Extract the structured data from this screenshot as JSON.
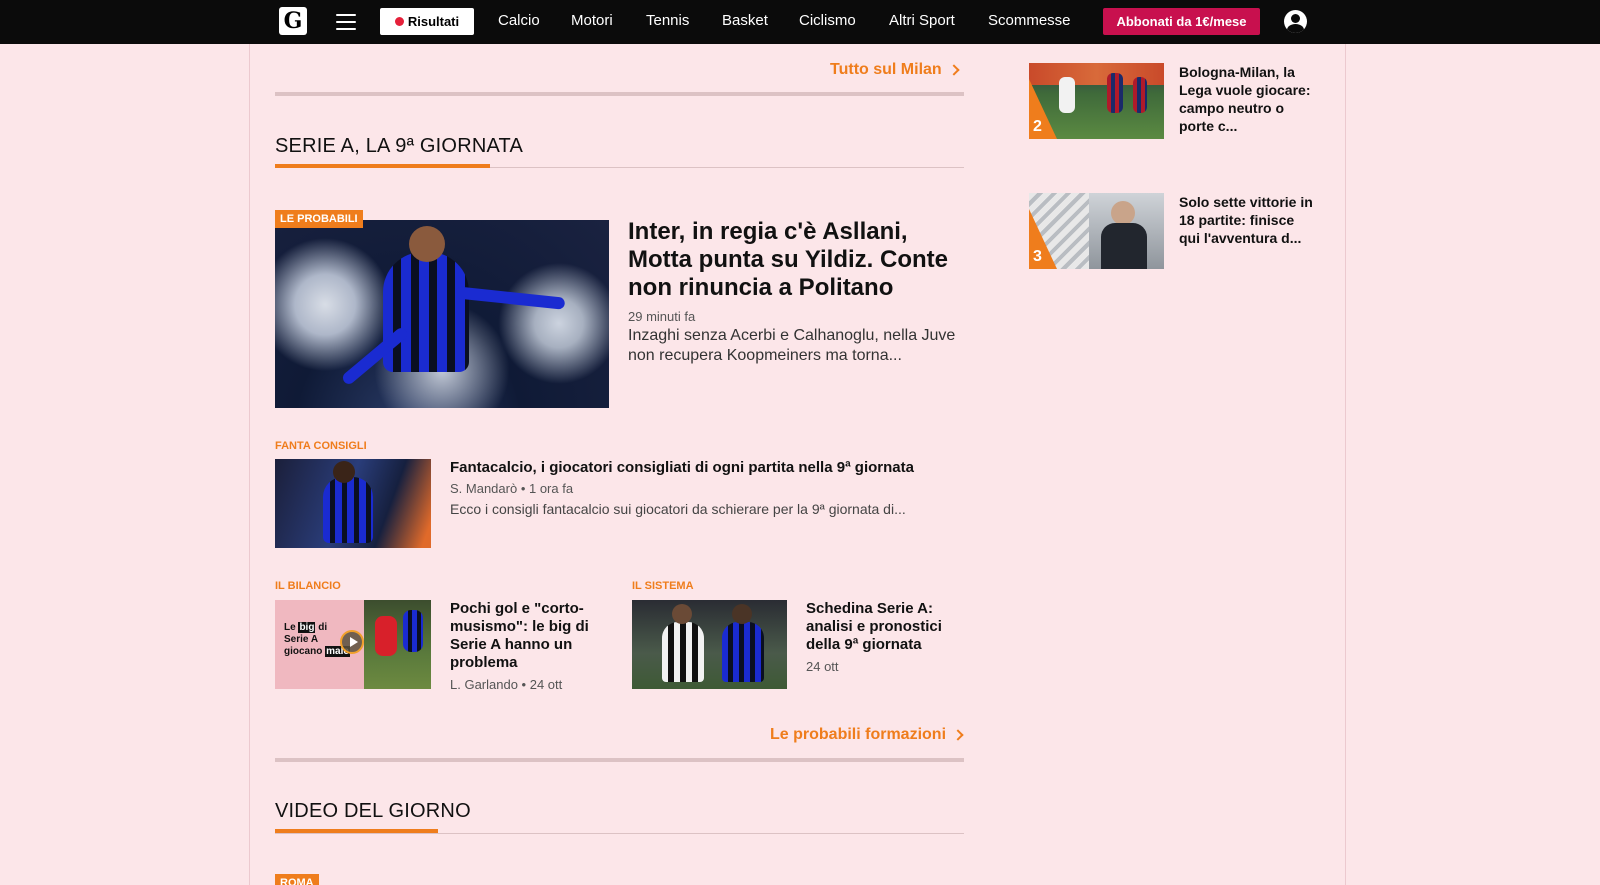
{
  "nav": {
    "logo_letter": "G",
    "risultati_label": "Risultati",
    "links": [
      "Calcio",
      "Motori",
      "Tennis",
      "Basket",
      "Ciclismo",
      "Altri Sport",
      "Scommesse"
    ],
    "subscribe_label": "Abbonati da 1€/mese"
  },
  "milan_section": {
    "more_label": "Tutto sul Milan"
  },
  "serie_a_section": {
    "title": "SERIE A, LA 9ª GIORNATA",
    "lead": {
      "tag": "LE PROBABILI",
      "headline": "Inter, in regia c'è Asllani, Motta punta su Yildiz. Conte non rinuncia a Politano",
      "time": "29 minuti fa",
      "summary": "Inzaghi senza Acerbi e Calhanoglu, nella Juve non recupera Koopmeiners ma torna..."
    },
    "second": {
      "tag": "FANTA CONSIGLI",
      "headline": "Fantacalcio, i giocatori consigliati di ogni partita nella 9ª giornata",
      "meta": "S. Mandarò • 1 ora fa",
      "summary": "Ecco i consigli fantacalcio sui giocatori da schierare per la 9ª giornata di..."
    },
    "third": {
      "tag": "IL BILANCIO",
      "headline": "Pochi gol e \"corto-musismo\": le big di Serie A hanno un problema",
      "meta": "L. Garlando • 24 ott",
      "thumb_text": [
        "Le",
        "big",
        "di",
        "Serie A",
        "giocano",
        "male"
      ]
    },
    "fourth": {
      "tag": "IL SISTEMA",
      "headline": "Schedina Serie A: analisi e pronostici della 9ª giornata",
      "meta": "24 ott"
    },
    "more_label": "Le probabili formazioni"
  },
  "video_section": {
    "title": "VIDEO DEL GIORNO",
    "tag": "ROMA"
  },
  "sidebar": {
    "items": [
      {
        "rank": "2",
        "title": "Bologna-Milan, la Lega vuole giocare: campo neutro o porte c..."
      },
      {
        "rank": "3",
        "title": "Solo sette vittorie in 18 partite: finisce qui l'avventura d..."
      }
    ]
  },
  "colors": {
    "accent": "#ef7d1c",
    "background": "#fce6e9",
    "subscribe": "#c8104e",
    "topbar": "#0b0b0b"
  }
}
